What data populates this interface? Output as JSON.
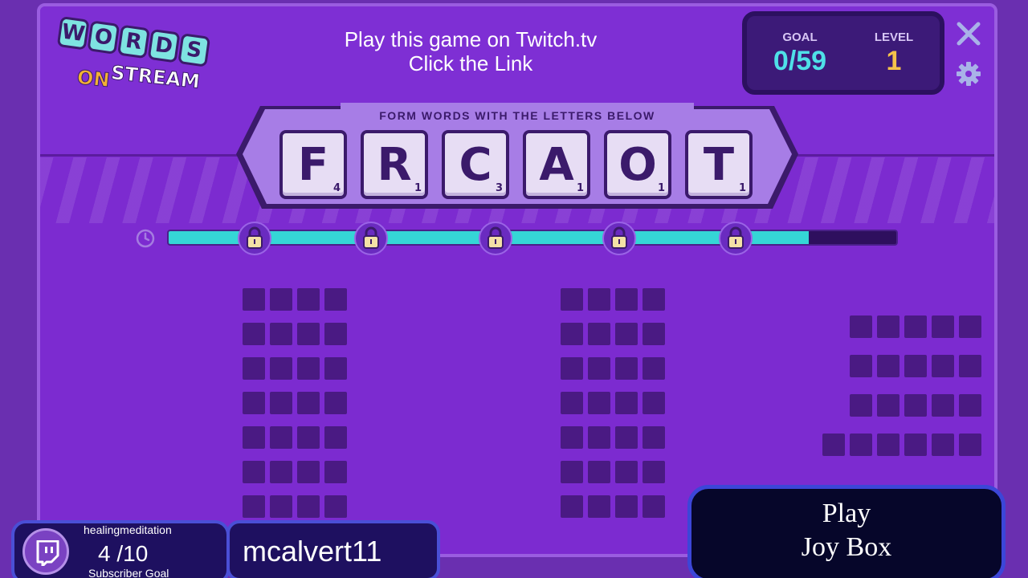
{
  "logo": {
    "letters": [
      "W",
      "O",
      "R",
      "D",
      "S"
    ],
    "on": "ON",
    "stream": "STREAM"
  },
  "promo": {
    "line1": "Play this game on Twitch.tv",
    "line2": "Click  the Link"
  },
  "goal": {
    "goal_label": "GOAL",
    "goal_value": "0/59",
    "level_label": "LEVEL",
    "level_value": "1"
  },
  "icons": {
    "close": "close-icon",
    "settings": "gear-icon",
    "timer": "clock-icon",
    "lock": "lock-icon",
    "twitch": "twitch-icon"
  },
  "banner": {
    "title": "FORM WORDS WITH THE LETTERS BELOW",
    "tiles": [
      {
        "letter": "F",
        "score": "4"
      },
      {
        "letter": "R",
        "score": "1"
      },
      {
        "letter": "C",
        "score": "3"
      },
      {
        "letter": "A",
        "score": "1"
      },
      {
        "letter": "O",
        "score": "1"
      },
      {
        "letter": "T",
        "score": "1"
      }
    ]
  },
  "timer": {
    "progress": 0.88,
    "lock_count": 5
  },
  "word_grids": [
    {
      "rows": [
        4,
        4,
        4,
        4,
        4,
        4,
        4
      ]
    },
    {
      "rows": [
        4,
        4,
        4,
        4,
        4,
        4,
        4
      ]
    },
    {
      "rows": [
        5,
        5,
        5,
        6
      ]
    }
  ],
  "subscriber": {
    "channel": "healingmeditation",
    "count": "4 /10",
    "label": "Subscriber Goal"
  },
  "user": {
    "name": "mcalvert11"
  },
  "joybox": {
    "line1": "Play",
    "line2": "Joy Box"
  },
  "colors": {
    "background": "#7c2bd0",
    "accent_cyan": "#4fe0e8",
    "accent_gold": "#f5c24a",
    "tile": "#e7ddf4",
    "ink": "#3b1a6b"
  }
}
